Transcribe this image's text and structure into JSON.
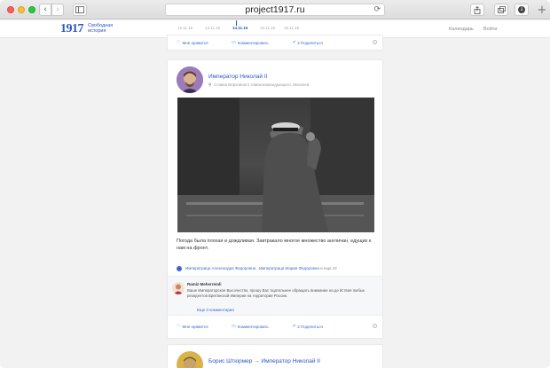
{
  "browser": {
    "url": "project1917.ru",
    "reload_icon": "⟳",
    "back_icon": "‹",
    "forward_icon": "›"
  },
  "site": {
    "logo_number": "1917",
    "logo_line1": "Свободная",
    "logo_line2": "история",
    "dates": [
      {
        "label": "12.11.16",
        "active": false
      },
      {
        "label": "13.11.16",
        "active": false
      },
      {
        "label": "14.11.16",
        "active": true
      },
      {
        "label": "15.11.16",
        "active": false
      },
      {
        "label": "16.11.16",
        "active": false
      }
    ],
    "calendar_link": "Календарь",
    "login_link": "Войти"
  },
  "actions": {
    "like": "Мне нравится",
    "comment": "Комментировать",
    "share": "2 Поделиться",
    "info": "i"
  },
  "post": {
    "author": "Император Николай II",
    "location": "Ставка Верховного главнокомандующего, Могилев",
    "text": "Погода была плохая и дождливая. Завтракало многое множество англичан, едущих к нам на  фронт.",
    "likes_names": "Императрица Александра Федоровна , Императрица Мария Федоровна",
    "likes_suffix": " и еще 24",
    "comment": {
      "author": "Ramiz Meherremli",
      "text": "Ваше Императорское Высочество, прошу Вас тщательнее обращать внимание на де йствия любых резидентов Британской Империи на территории России.",
      "more": "Еще 3 комментария"
    }
  },
  "next_post": {
    "author": "Борис Штюрмер → Император Николай II"
  },
  "colors": {
    "accent": "#2b56c7",
    "link": "#3a66d0"
  }
}
